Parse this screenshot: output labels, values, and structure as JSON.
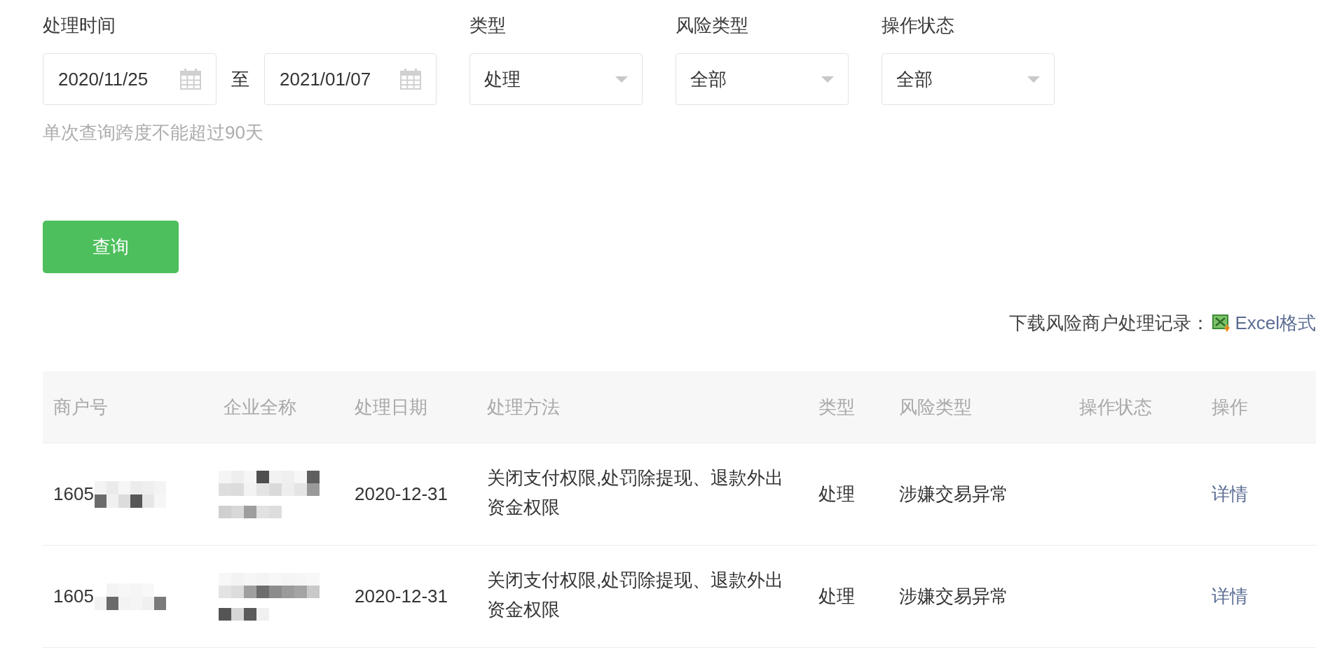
{
  "filters": {
    "date_range": {
      "label": "处理时间",
      "start": "2020/11/25",
      "separator": "至",
      "end": "2021/01/07",
      "hint": "单次查询跨度不能超过90天"
    },
    "selects": [
      {
        "label": "类型",
        "value": "处理"
      },
      {
        "label": "风险类型",
        "value": "全部"
      },
      {
        "label": "操作状态",
        "value": "全部"
      }
    ]
  },
  "query_button": "查询",
  "download": {
    "label": "下载风险商户处理记录：",
    "link": "Excel格式"
  },
  "table": {
    "columns": [
      "商户号",
      "企业全称",
      "处理日期",
      "处理方法",
      "类型",
      "风险类型",
      "操作状态",
      "操作"
    ],
    "rows": [
      {
        "merchant_no": {
          "text": "1605",
          "redacted": true
        },
        "company": {
          "redacted": true
        },
        "date": "2020-12-31",
        "method": "关闭支付权限,处罚除提现、退款外出资金权限",
        "type": "处理",
        "risk_type": "涉嫌交易异常",
        "action": "详情"
      },
      {
        "merchant_no": {
          "text": "1605",
          "redacted": true
        },
        "company": {
          "redacted": true
        },
        "date": "2020-12-31",
        "method": "关闭支付权限,处罚除提现、退款外出资金权限",
        "type": "处理",
        "risk_type": "涉嫌交易异常",
        "action": "详情"
      }
    ]
  }
}
